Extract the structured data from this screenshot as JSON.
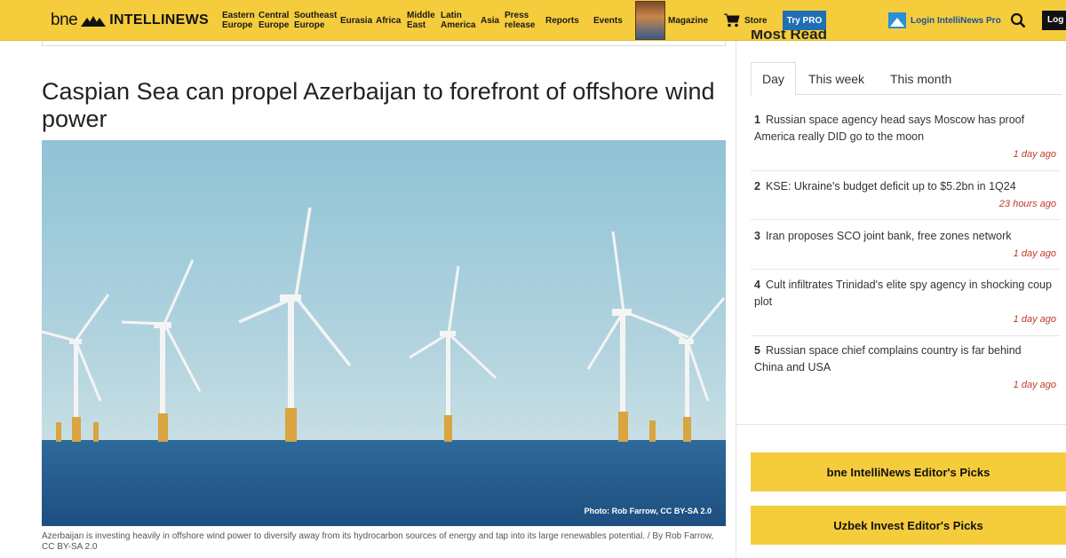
{
  "header": {
    "logo_bne": "bne",
    "logo_brand": "INTELLINEWS",
    "nav": [
      {
        "l1": "Eastern",
        "l2": "Europe"
      },
      {
        "l1": "Central",
        "l2": "Europe"
      },
      {
        "l1": "Southeast",
        "l2": "Europe"
      },
      {
        "l1": "Eurasia",
        "l2": ""
      },
      {
        "l1": "Africa",
        "l2": ""
      },
      {
        "l1": "Middle",
        "l2": "East"
      },
      {
        "l1": "Latin",
        "l2": "America"
      },
      {
        "l1": "Asia",
        "l2": ""
      },
      {
        "l1": "Press",
        "l2": "release"
      },
      {
        "l1": "Reports",
        "l2": ""
      },
      {
        "l1": "Events",
        "l2": ""
      }
    ],
    "magazine_label": "Magazine",
    "store_label": "Store",
    "try_pro_label": "Try PRO",
    "login_pro_label": "Login IntelliNews Pro",
    "login_label": "Log In",
    "accent": "#f5cc3c",
    "pro_color": "#1f6fb5"
  },
  "article": {
    "headline": "Caspian Sea can propel Azerbaijan to forefront of offshore wind power",
    "photo_credit": "Photo: Rob Farrow, CC BY-SA 2.0",
    "caption": "Azerbaijan is investing heavily in offshore wind power to diversify away from its hydrocarbon sources of energy and tap into its large renewables potential. / By Rob Farrow, CC BY-SA 2.0"
  },
  "sidebar": {
    "most_read_title": "Most Read",
    "tabs": [
      {
        "label": "Day",
        "active": true
      },
      {
        "label": "This week",
        "active": false
      },
      {
        "label": "This month",
        "active": false
      }
    ],
    "items": [
      {
        "num": "1",
        "title": "Russian space agency head says Moscow has proof America really DID go to the moon",
        "time": "1 day ago"
      },
      {
        "num": "2",
        "title": "KSE: Ukraine's budget deficit up to $5.2bn in 1Q24",
        "time": "23 hours ago"
      },
      {
        "num": "3",
        "title": "Iran proposes SCO joint bank, free zones network",
        "time": "1 day ago"
      },
      {
        "num": "4",
        "title": "Cult infiltrates Trinidad's elite spy agency in shocking coup plot",
        "time": "1 day ago"
      },
      {
        "num": "5",
        "title": "Russian space chief complains country is far behind China and USA",
        "time": "1 day ago"
      }
    ],
    "picks": [
      "bne IntelliNews Editor's Picks",
      "Uzbek Invest Editor's Picks"
    ]
  }
}
